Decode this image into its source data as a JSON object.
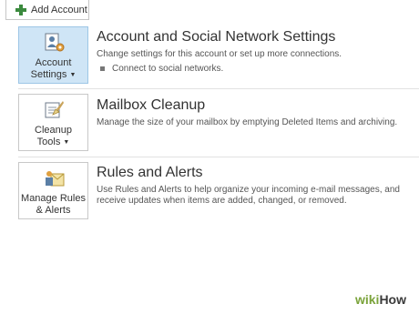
{
  "toolbar": {
    "add_account_label": "Add Account"
  },
  "sections": [
    {
      "tile_line1": "Account",
      "tile_line2": "Settings",
      "title": "Account and Social Network Settings",
      "description": "Change settings for this account or set up more connections.",
      "bullet": "Connect to social networks."
    },
    {
      "tile_line1": "Cleanup",
      "tile_line2": "Tools",
      "title": "Mailbox Cleanup",
      "description": "Manage the size of your mailbox by emptying Deleted Items and archiving."
    },
    {
      "tile_line1": "Manage Rules",
      "tile_line2": "& Alerts",
      "title": "Rules and Alerts",
      "description": "Use Rules and Alerts to help organize your incoming e-mail messages, and receive updates when items are added, changed, or removed."
    }
  ],
  "watermark": {
    "part1": "wiki",
    "part2": "How"
  }
}
